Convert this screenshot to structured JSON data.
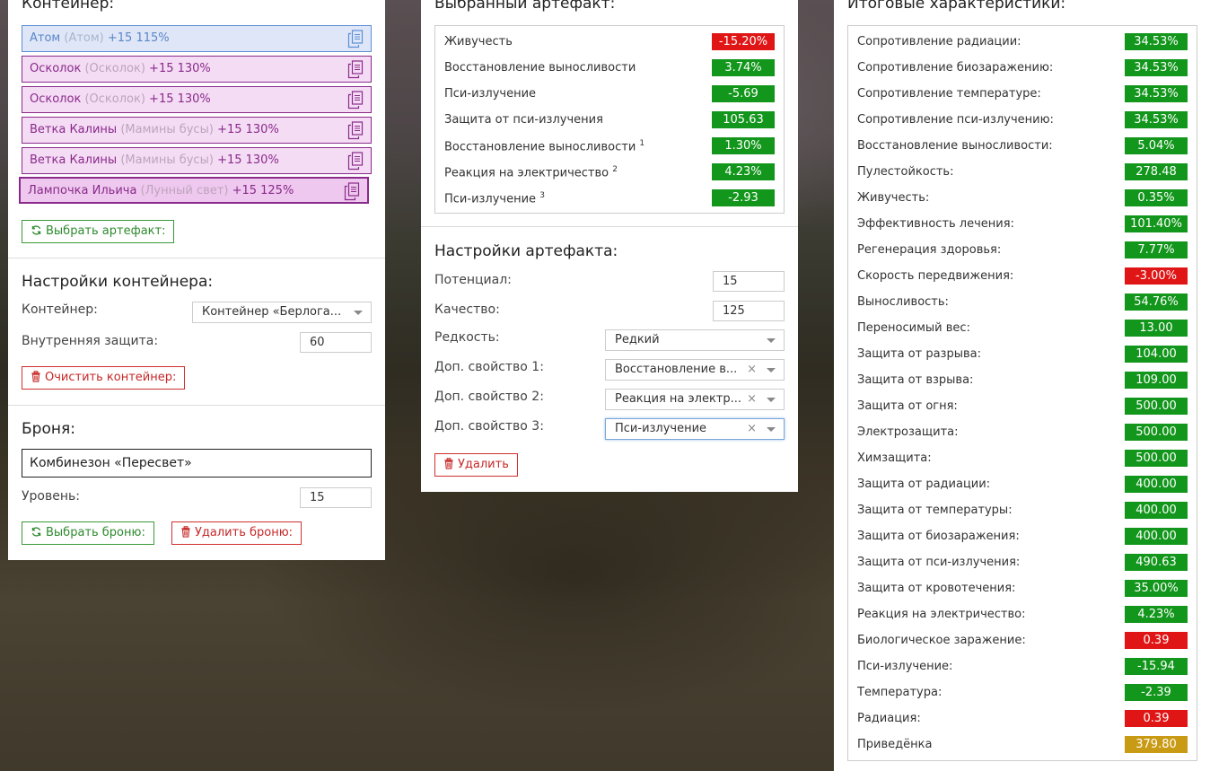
{
  "container": {
    "heading": "Контейнер:",
    "slots": [
      {
        "name": "Атом",
        "sub": "(Атом)",
        "level": "+15 115%",
        "type": "atom"
      },
      {
        "name": "Осколок",
        "sub": "(Осколок)",
        "level": "+15 130%",
        "type": "artifact"
      },
      {
        "name": "Осколок",
        "sub": "(Осколок)",
        "level": "+15 130%",
        "type": "artifact"
      },
      {
        "name": "Ветка Калины",
        "sub": "(Мамины бусы)",
        "level": "+15 130%",
        "type": "artifact"
      },
      {
        "name": "Ветка Калины",
        "sub": "(Мамины бусы)",
        "level": "+15 130%",
        "type": "artifact"
      },
      {
        "name": "Лампочка Ильича",
        "sub": "(Лунный свет)",
        "level": "+15 125%",
        "type": "artifact-selected"
      }
    ],
    "select_artifact_button": "Выбрать артефакт:"
  },
  "container_settings": {
    "heading": "Настройки контейнера:",
    "container_label": "Контейнер:",
    "container_value": "Контейнер «Берлога...",
    "internal_protection_label": "Внутренняя защита:",
    "internal_protection_value": "60",
    "clear_button": "Очистить контейнер:"
  },
  "armor": {
    "heading": "Броня:",
    "name": "Комбинезон «Пересвет»",
    "level_label": "Уровень:",
    "level_value": "15",
    "select_button": "Выбрать броню:",
    "delete_button": "Удалить броню:"
  },
  "selected_artifact": {
    "heading": "Выбранный артефакт:",
    "stats": [
      {
        "label": "Живучесть",
        "sup": "",
        "value": "-15.20%",
        "color": "red"
      },
      {
        "label": "Восстановление выносливости",
        "sup": "",
        "value": "3.74%",
        "color": "green"
      },
      {
        "label": "Пси-излучение",
        "sup": "",
        "value": "-5.69",
        "color": "green"
      },
      {
        "label": "Защита от пси-излучения",
        "sup": "",
        "value": "105.63",
        "color": "green"
      },
      {
        "label": "Восстановление выносливости",
        "sup": "1",
        "value": "1.30%",
        "color": "green"
      },
      {
        "label": "Реакция на электричество",
        "sup": "2",
        "value": "4.23%",
        "color": "green"
      },
      {
        "label": "Пси-излучение",
        "sup": "3",
        "value": "-2.93",
        "color": "green"
      }
    ]
  },
  "artifact_settings": {
    "heading": "Настройки артефакта:",
    "potential_label": "Потенциал:",
    "potential_value": "15",
    "quality_label": "Качество:",
    "quality_value": "125",
    "rarity_label": "Редкость:",
    "rarity_value": "Редкий",
    "extra1_label": "Доп. свойство 1:",
    "extra1_value": "Восстановление в...",
    "extra2_label": "Доп. свойство 2:",
    "extra2_value": "Реакция на электр...",
    "extra3_label": "Доп. свойство 3:",
    "extra3_value": "Пси-излучение",
    "clear_symbol": "×",
    "delete_button": "Удалить"
  },
  "totals": {
    "heading": "Итоговые характеристики:",
    "stats": [
      {
        "label": "Сопротивление радиации:",
        "value": "34.53%",
        "color": "green"
      },
      {
        "label": "Сопротивление биозаражению:",
        "value": "34.53%",
        "color": "green"
      },
      {
        "label": "Сопротивление температуре:",
        "value": "34.53%",
        "color": "green"
      },
      {
        "label": "Сопротивление пси-излучению:",
        "value": "34.53%",
        "color": "green"
      },
      {
        "label": "Восстановление выносливости:",
        "value": "5.04%",
        "color": "green"
      },
      {
        "label": "Пулестойкость:",
        "value": "278.48",
        "color": "green"
      },
      {
        "label": "Живучесть:",
        "value": "0.35%",
        "color": "green"
      },
      {
        "label": "Эффективность лечения:",
        "value": "101.40%",
        "color": "green"
      },
      {
        "label": "Регенерация здоровья:",
        "value": "7.77%",
        "color": "green"
      },
      {
        "label": "Скорость передвижения:",
        "value": "-3.00%",
        "color": "red"
      },
      {
        "label": "Выносливость:",
        "value": "54.76%",
        "color": "green"
      },
      {
        "label": "Переносимый вес:",
        "value": "13.00",
        "color": "green"
      },
      {
        "label": "Защита от разрыва:",
        "value": "104.00",
        "color": "green"
      },
      {
        "label": "Защита от взрыва:",
        "value": "109.00",
        "color": "green"
      },
      {
        "label": "Защита от огня:",
        "value": "500.00",
        "color": "green"
      },
      {
        "label": "Электрозащита:",
        "value": "500.00",
        "color": "green"
      },
      {
        "label": "Химзащита:",
        "value": "500.00",
        "color": "green"
      },
      {
        "label": "Защита от радиации:",
        "value": "400.00",
        "color": "green"
      },
      {
        "label": "Защита от температуры:",
        "value": "400.00",
        "color": "green"
      },
      {
        "label": "Защита от биозаражения:",
        "value": "400.00",
        "color": "green"
      },
      {
        "label": "Защита от пси-излучения:",
        "value": "490.63",
        "color": "green"
      },
      {
        "label": "Защита от кровотечения:",
        "value": "35.00%",
        "color": "green"
      },
      {
        "label": "Реакция на электричество:",
        "value": "4.23%",
        "color": "green"
      },
      {
        "label": "Биологическое заражение:",
        "value": "0.39",
        "color": "red"
      },
      {
        "label": "Пси-излучение:",
        "value": "-15.94",
        "color": "green"
      },
      {
        "label": "Температура:",
        "value": "-2.39",
        "color": "green"
      },
      {
        "label": "Радиация:",
        "value": "0.39",
        "color": "red"
      },
      {
        "label": "Приведёнка",
        "value": "379.80",
        "color": "gold"
      }
    ]
  },
  "icons": {
    "copy": "copy-icon",
    "refresh": "refresh-icon",
    "trash": "trash-icon"
  },
  "colors": {
    "green": "#12961b",
    "red": "#e01515",
    "gold": "#c99a14",
    "artifact_slot_border": "#8a2a8a",
    "artifact_slot_bg": "#f4dcf4",
    "atom_slot_border": "#5b8fd6",
    "atom_slot_bg": "#dfe6f7"
  }
}
